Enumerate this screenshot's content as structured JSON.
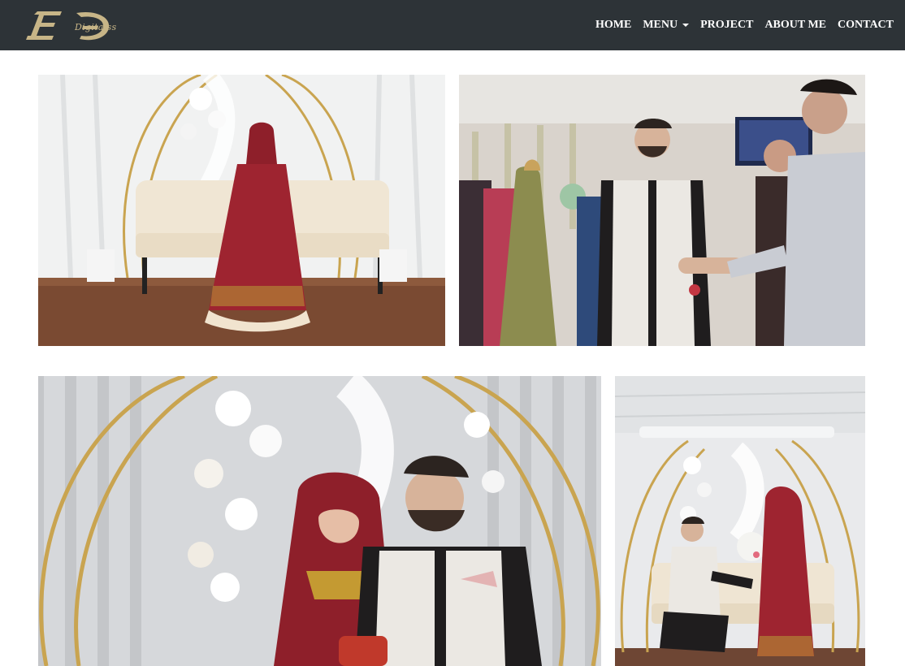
{
  "brand": {
    "logo_letters": "EƐ",
    "logo_script": "Digitalss"
  },
  "nav": {
    "items": [
      {
        "label": "HOME"
      },
      {
        "label": "MENU",
        "has_dropdown": true
      },
      {
        "label": "PROJECT"
      },
      {
        "label": "ABOUT ME"
      },
      {
        "label": "CONTACT"
      }
    ]
  },
  "colors": {
    "navbar_bg": "#2d3337",
    "nav_text": "#ffffff",
    "logo_gold": "#c7b587",
    "page_bg": "#ffffff"
  },
  "gallery": {
    "photos": [
      {
        "subject": "bride-seated-on-sofa"
      },
      {
        "subject": "groom-handshake-with-guest"
      },
      {
        "subject": "couple-close-up-exchange"
      },
      {
        "subject": "groom-kneeling-with-bouquet"
      }
    ]
  }
}
